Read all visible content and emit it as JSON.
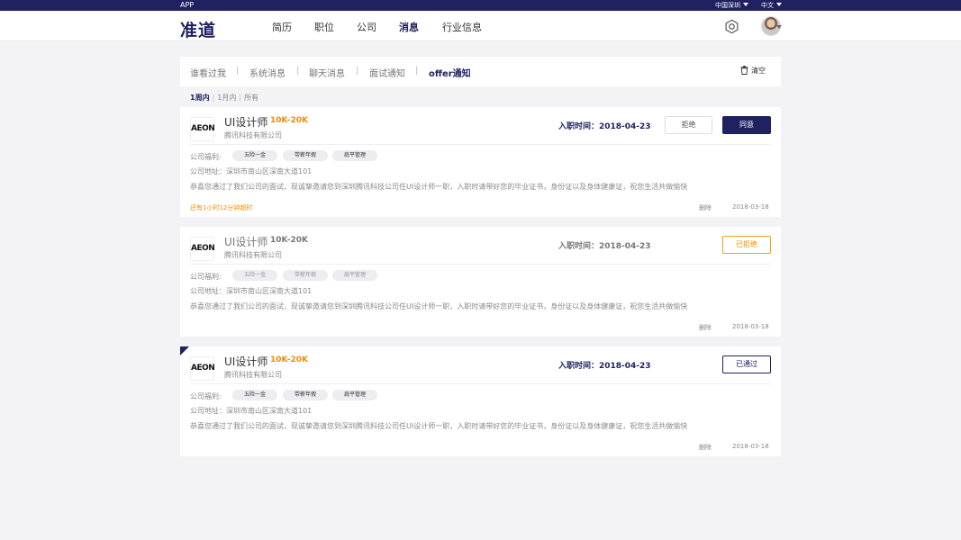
{
  "topbar": {
    "app": "APP",
    "region": "中国深圳",
    "language": "中文"
  },
  "header": {
    "logo": "准道",
    "nav": [
      "简历",
      "职位",
      "公司",
      "消息",
      "行业信息"
    ],
    "active_nav": "消息"
  },
  "tabs": {
    "items": [
      "谁看过我",
      "系统消息",
      "聊天消息",
      "面试通知",
      "offer通知"
    ],
    "separator": "|",
    "active": "offer通知",
    "clear_label": "清空"
  },
  "filters": {
    "items": [
      "1周内",
      "1月内",
      "所有"
    ],
    "separator": "|",
    "active": "1周内"
  },
  "labels": {
    "benefit": "公司福利:",
    "delete": "删除"
  },
  "cards": [
    {
      "logo_text": "AEON",
      "title": "UI设计师",
      "salary": "10K-20K",
      "company": "腾讯科技有限公司",
      "entry_time": "入职时间：2018-04-23",
      "benefits": [
        "五险一金",
        "带薪年假",
        "肩平管理"
      ],
      "address": "公司地址：深圳市南山区深南大道101",
      "message": "恭喜您通过了我们公司的面试，现诚挚邀请您到深圳腾讯科技公司任UI设计师一职，入职时请带好您的毕业证书，身份证以及身体健康证，祝您生活共做愉快",
      "remaining": "还有1小时12分钟超时",
      "date": "2018-03-18",
      "reject_label": "拒绝",
      "accept_label": "同意"
    },
    {
      "logo_text": "AEON",
      "title": "UI设计师",
      "salary": "10K-20K",
      "company": "腾讯科技有限公司",
      "entry_time": "入职时间：2018-04-23",
      "benefits": [
        "五险一金",
        "带薪年假",
        "肩平管理"
      ],
      "address": "公司地址：深圳市南山区深南大道101",
      "message": "恭喜您通过了我们公司的面试，现诚挚邀请您到深圳腾讯科技公司任UI设计师一职，入职时请带好您的毕业证书，身份证以及身体健康证，祝您生活共做愉快",
      "date": "2018-03-18",
      "status_label": "已拒绝"
    },
    {
      "logo_text": "AEON",
      "title": "UI设计师",
      "salary": "10K-20K",
      "company": "腾讯科技有限公司",
      "entry_time": "入职时间：2018-04-23",
      "benefits": [
        "五险一金",
        "带薪年假",
        "肩平管理"
      ],
      "address": "公司地址：深圳市南山区深南大道101",
      "message": "恭喜您通过了我们公司的面试，现诚挚邀请您到深圳腾讯科技公司任UI设计师一职，入职时请带好您的毕业证书，身份证以及身体健康证，祝您生活共做愉快",
      "date": "2018-03-18",
      "status_label": "已通过"
    }
  ],
  "colors": {
    "brand": "#1f2160",
    "accent": "#f08c00"
  }
}
